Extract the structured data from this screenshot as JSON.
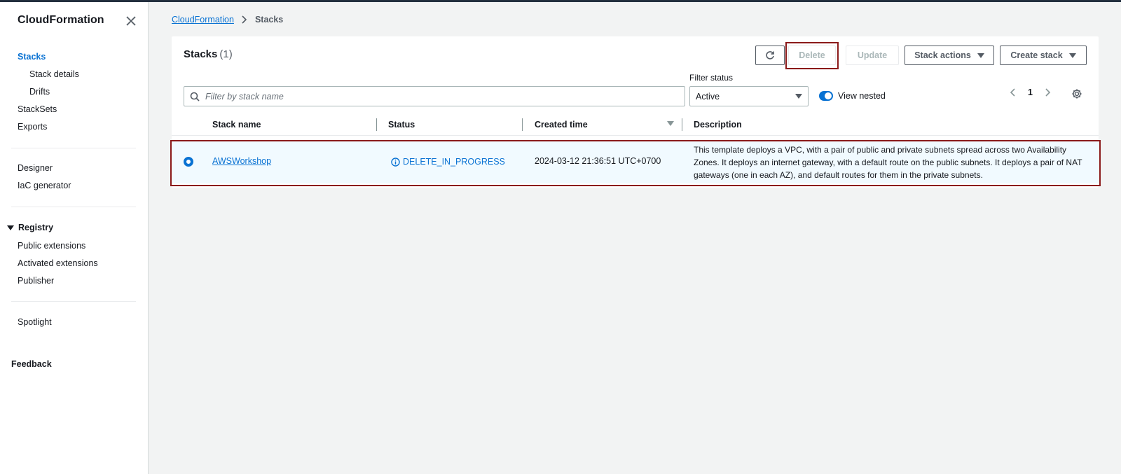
{
  "sidebar": {
    "title": "CloudFormation",
    "items": [
      {
        "label": "Stacks"
      },
      {
        "label": "Stack details"
      },
      {
        "label": "Drifts"
      },
      {
        "label": "StackSets"
      },
      {
        "label": "Exports"
      },
      {
        "label": "Designer"
      },
      {
        "label": "IaC generator"
      },
      {
        "label": "Public extensions"
      },
      {
        "label": "Activated extensions"
      },
      {
        "label": "Publisher"
      },
      {
        "label": "Spotlight"
      }
    ],
    "registry_label": "Registry",
    "feedback_label": "Feedback"
  },
  "breadcrumb": {
    "root": "CloudFormation",
    "current": "Stacks"
  },
  "stacks_panel": {
    "title": "Stacks",
    "count": "(1)",
    "buttons": {
      "delete": "Delete",
      "update": "Update",
      "stack_actions": "Stack actions",
      "create_stack": "Create stack"
    },
    "search_placeholder": "Filter by stack name",
    "filter_status_label": "Filter status",
    "filter_status_value": "Active",
    "view_nested_label": "View nested",
    "current_page": "1",
    "columns": [
      "Stack name",
      "Status",
      "Created time",
      "Description"
    ],
    "rows": [
      {
        "stack_name": "AWSWorkshop",
        "status": "DELETE_IN_PROGRESS",
        "created_time": "2024-03-12 21:36:51 UTC+0700",
        "description": "This template deploys a VPC, with a pair of public and private subnets spread across two Availability Zones. It deploys an internet gateway, with a default route on the public subnets. It deploys a pair of NAT gateways (one in each AZ), and default routes for them in the private subnets."
      }
    ]
  },
  "colors": {
    "accent": "#0972d3",
    "highlight": "#8b1a1a",
    "selected_row": "#f1faff"
  }
}
